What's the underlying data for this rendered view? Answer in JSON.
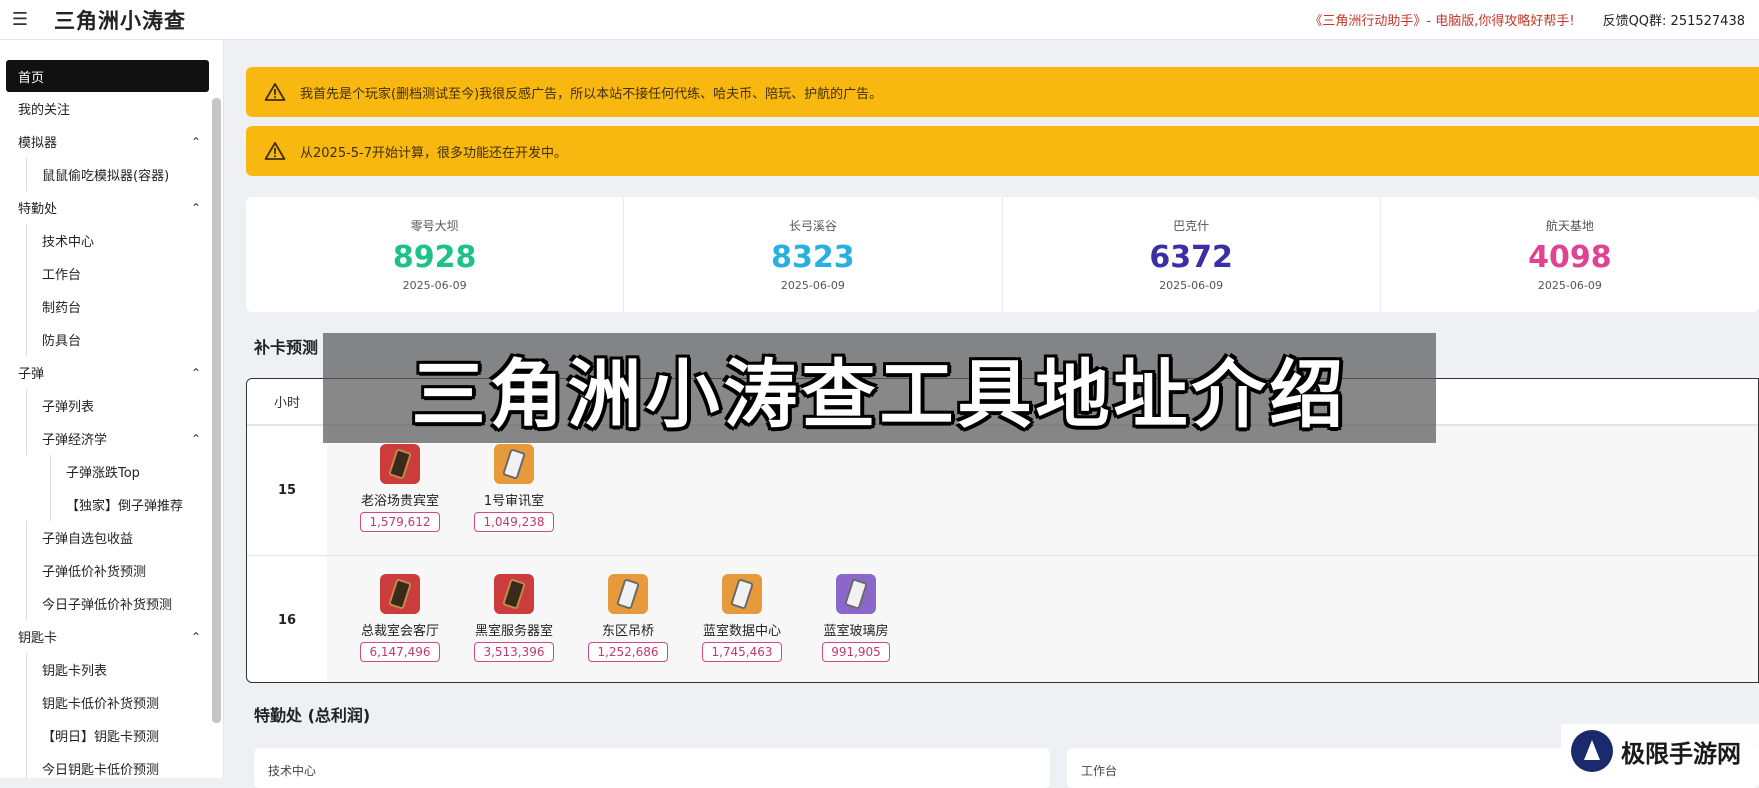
{
  "header": {
    "brand": "三角洲小涛查",
    "promo": "《三角洲行动助手》- 电脑版,你得攻略好帮手!",
    "qq": "反馈QQ群: 251527438"
  },
  "sidebar": {
    "items": [
      {
        "label": "首页"
      },
      {
        "label": "我的关注"
      },
      {
        "label": "模拟器"
      },
      {
        "label": "鼠鼠偷吃模拟器(容器)"
      },
      {
        "label": "特勤处"
      },
      {
        "label": "技术中心"
      },
      {
        "label": "工作台"
      },
      {
        "label": "制药台"
      },
      {
        "label": "防具台"
      },
      {
        "label": "子弹"
      },
      {
        "label": "子弹列表"
      },
      {
        "label": "子弹经济学"
      },
      {
        "label": "子弹涨跌Top"
      },
      {
        "label": "【独家】倒子弹推荐"
      },
      {
        "label": "子弹自选包收益"
      },
      {
        "label": "子弹低价补货预测"
      },
      {
        "label": "今日子弹低价补货预测"
      },
      {
        "label": "钥匙卡"
      },
      {
        "label": "钥匙卡列表"
      },
      {
        "label": "钥匙卡低价补货预测"
      },
      {
        "label": "【明日】钥匙卡预测"
      },
      {
        "label": "今日钥匙卡低价预测"
      }
    ]
  },
  "alerts": [
    {
      "text": "我首先是个玩家(删档测试至今)我很反感广告，所以本站不接任何代练、哈夫币、陪玩、护航的广告。"
    },
    {
      "text": "从2025-5-7开始计算，很多功能还在开发中。"
    }
  ],
  "stats": [
    {
      "label": "零号大坝",
      "value": "8928",
      "date": "2025-06-09",
      "color": "#1fc18a"
    },
    {
      "label": "长弓溪谷",
      "value": "8323",
      "date": "2025-06-09",
      "color": "#2ab0e0"
    },
    {
      "label": "巴克什",
      "value": "6372",
      "date": "2025-06-09",
      "color": "#3b2fa5"
    },
    {
      "label": "航天基地",
      "value": "4098",
      "date": "2025-06-09",
      "color": "#e04392"
    }
  ],
  "restock": {
    "title": "补卡预测",
    "hour_header": "小时",
    "rows": [
      {
        "hour": "15",
        "items": [
          {
            "name": "老浴场贵宾室",
            "price": "1,579,612",
            "color": "red"
          },
          {
            "name": "1号审讯室",
            "price": "1,049,238",
            "color": "orange"
          }
        ]
      },
      {
        "hour": "16",
        "items": [
          {
            "name": "总裁室会客厅",
            "price": "6,147,496",
            "color": "red"
          },
          {
            "name": "黑室服务器室",
            "price": "3,513,396",
            "color": "red"
          },
          {
            "name": "东区吊桥",
            "price": "1,252,686",
            "color": "orange"
          },
          {
            "name": "蓝室数据中心",
            "price": "1,745,463",
            "color": "orange"
          },
          {
            "name": "蓝室玻璃房",
            "price": "991,905",
            "color": "purple"
          }
        ]
      }
    ]
  },
  "profit": {
    "title": "特勤处 (总利润)",
    "cards": [
      {
        "label": "技术中心"
      },
      {
        "label": "工作台"
      }
    ]
  },
  "overlay": {
    "banner": "三角洲小涛查工具地址介绍",
    "watermark": "极限手游网"
  }
}
